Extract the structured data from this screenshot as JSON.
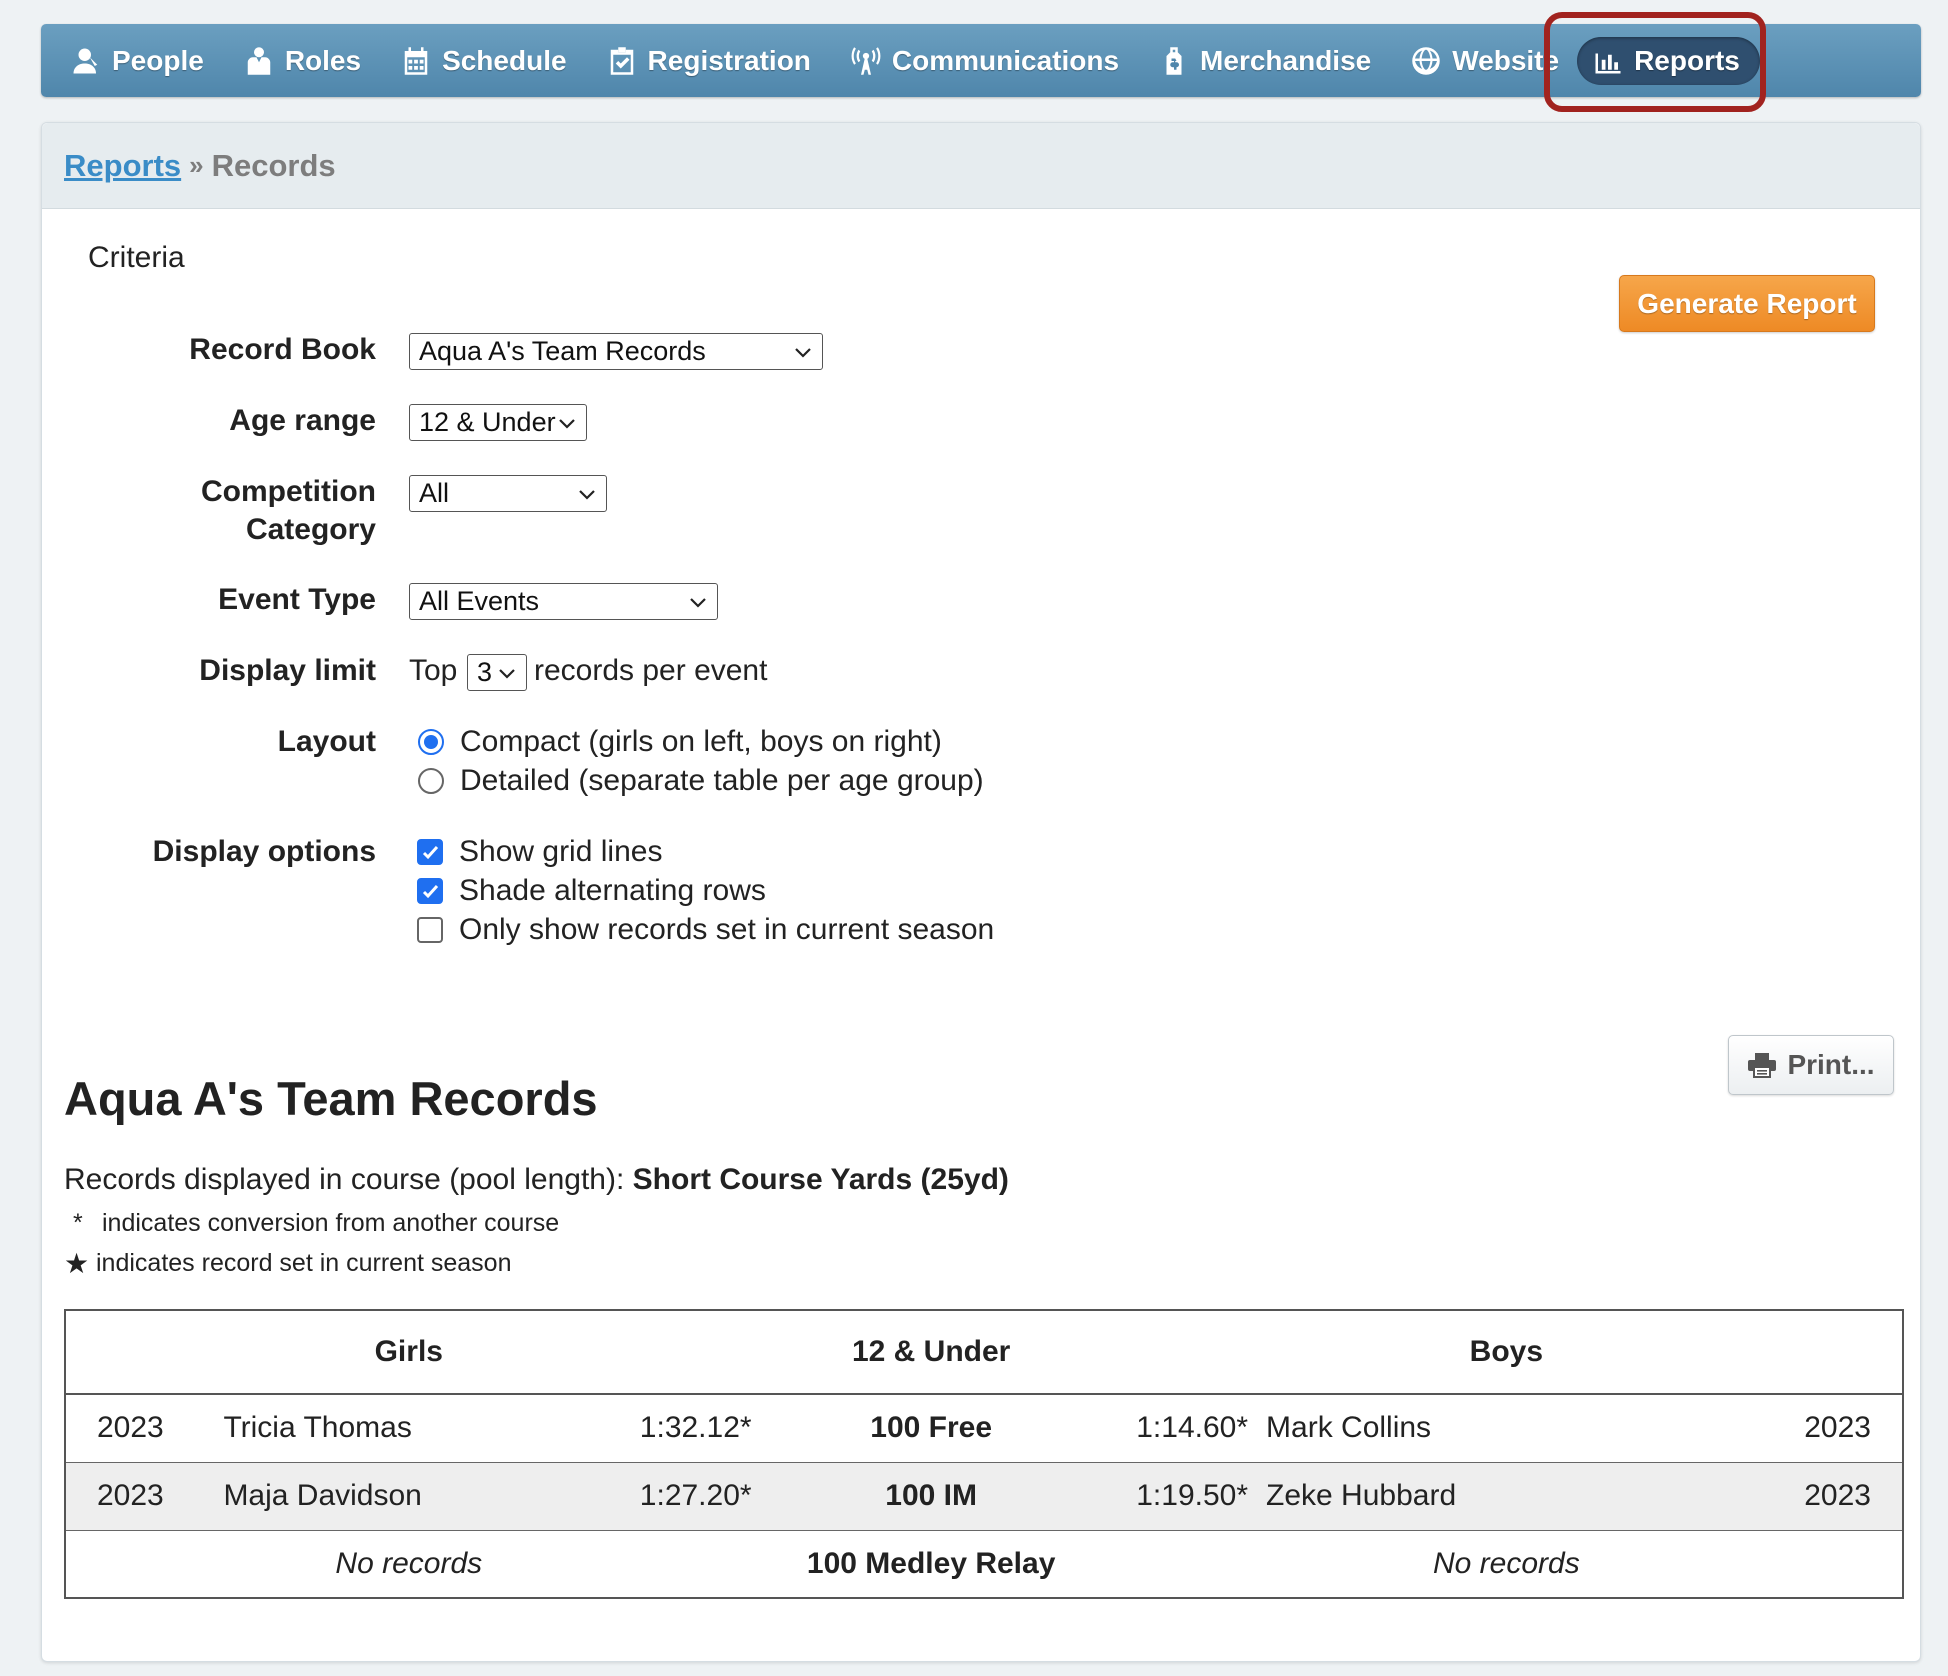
{
  "nav": {
    "items": [
      {
        "label": "People",
        "icon": "person-icon"
      },
      {
        "label": "Roles",
        "icon": "roles-icon"
      },
      {
        "label": "Schedule",
        "icon": "calendar-icon"
      },
      {
        "label": "Registration",
        "icon": "clipboard-check-icon"
      },
      {
        "label": "Communications",
        "icon": "broadcast-icon"
      },
      {
        "label": "Merchandise",
        "icon": "price-tag-icon"
      },
      {
        "label": "Website",
        "icon": "globe-icon"
      },
      {
        "label": "Reports",
        "icon": "bar-chart-icon",
        "active": true
      }
    ],
    "highlight_color": "#a1231f",
    "active_bg": "#2f4f6f"
  },
  "breadcrumb": {
    "link": "Reports",
    "separator": "»",
    "current": "Records"
  },
  "criteria": {
    "title": "Criteria",
    "generate_label": "Generate Report",
    "record_book": {
      "label": "Record Book",
      "value": "Aqua A's Team Records"
    },
    "age_range": {
      "label": "Age range",
      "value": "12 & Under"
    },
    "competition_category": {
      "label_line1": "Competition",
      "label_line2": "Category",
      "value": "All"
    },
    "event_type": {
      "label": "Event Type",
      "value": "All Events"
    },
    "display_limit": {
      "label": "Display limit",
      "prefix": "Top",
      "value": "3",
      "suffix": "records per event"
    },
    "layout": {
      "label": "Layout",
      "options": [
        {
          "label": "Compact (girls on left, boys on right)",
          "selected": true
        },
        {
          "label": "Detailed (separate table per age group)",
          "selected": false
        }
      ]
    },
    "display_options": {
      "label": "Display options",
      "options": [
        {
          "label": "Show grid lines",
          "checked": true
        },
        {
          "label": "Shade alternating rows",
          "checked": true
        },
        {
          "label": "Only show records set in current season",
          "checked": false
        }
      ]
    }
  },
  "report": {
    "print_label": "Print...",
    "title": "Aqua A's Team Records",
    "course_prefix": "Records displayed in course (pool length):",
    "course_value": "Short Course Yards (25yd)",
    "legend_conversion_symbol": "*",
    "legend_conversion": "indicates conversion from another course",
    "legend_season_symbol": "★",
    "legend_season": "indicates record set in current season",
    "table": {
      "headers": {
        "girls": "Girls",
        "age": "12 & Under",
        "boys": "Boys"
      },
      "rows": [
        {
          "girl_year": "2023",
          "girl_name": "Tricia Thomas",
          "girl_time": "1:32.12*",
          "event": "100 Free",
          "boy_time": "1:14.60*",
          "boy_name": "Mark Collins",
          "boy_year": "2023"
        },
        {
          "girl_year": "2023",
          "girl_name": "Maja Davidson",
          "girl_time": "1:27.20*",
          "event": "100 IM",
          "boy_time": "1:19.50*",
          "boy_name": "Zeke Hubbard",
          "boy_year": "2023"
        }
      ],
      "relay_row": {
        "girls": "No records",
        "event": "100 Medley Relay",
        "boys": "No records"
      }
    }
  },
  "colors": {
    "nav_gradient_top": "#6b9fc0",
    "nav_gradient_bottom": "#4f86ab",
    "link": "#3a8cc7",
    "generate_button": "#ee8a25",
    "control_accent": "#1f6ff0"
  }
}
